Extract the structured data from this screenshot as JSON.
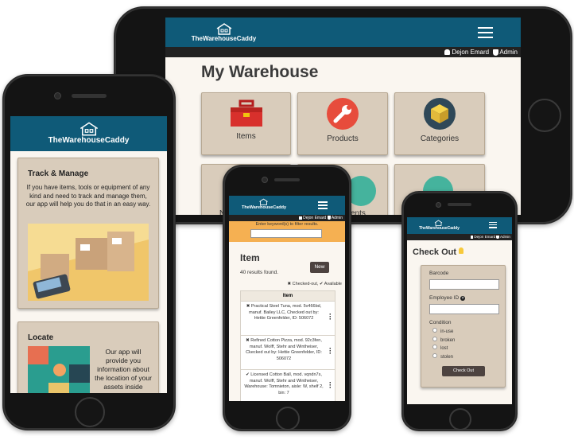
{
  "brand": {
    "name": "TheWarehouseCaddy",
    "color": "#0f5a78"
  },
  "user": {
    "name": "Dejon Emard",
    "role": "Admin"
  },
  "tablet": {
    "page_title": "My Warehouse",
    "tiles": [
      {
        "label": "Items",
        "icon": "toolbox-icon"
      },
      {
        "label": "Products",
        "icon": "wrench-icon"
      },
      {
        "label": "Categories",
        "icon": "box-icon"
      }
    ],
    "row2_partial": [
      "N",
      "ents"
    ]
  },
  "phone_left": {
    "card1": {
      "title": "Track & Manage",
      "body": "If you have items, tools or equipment of any kind and need to track and manage them, our app will help you do that in an easy way."
    },
    "card2": {
      "title": "Locate",
      "body": "Our app will provide you information about the location of your assets inside"
    }
  },
  "phone_mid": {
    "filter_hint": "Enter keyword(s) to filter results.",
    "filter_value": "",
    "title": "Item",
    "results": "40 results found.",
    "new_button": "New",
    "legend_checked_out": "Checked-out,",
    "legend_available": "Available",
    "table_header": "Item",
    "rows": [
      {
        "status": "✖",
        "text": "Practical Steel Tuna, mod. 5v466bd, manuf. Bailey LLC, Checked out by: Hettie Greenfelder, ID: 506072"
      },
      {
        "status": "✖",
        "text": "Refined Cotton Pizza, mod. 92c3fen, manuf. Wolff, Stehr and Wintheiser, Ckecked out by: Hettie Greenfelder, ID: 506072"
      },
      {
        "status": "✔",
        "text": "Licensed Cotton Ball, mod. vqndn7s, manuf. Wolff, Stehr and Wintheiser, Warehouse: Tomnieton, aisle: W, shelf 2, bin: 7"
      }
    ]
  },
  "phone_right": {
    "title": "Check Out",
    "barcode_label": "Barcode",
    "barcode_value": "",
    "employee_label": "Employee ID",
    "employee_value": "",
    "condition_label": "Condition",
    "conditions": [
      "in-use",
      "broken",
      "lost",
      "stolen"
    ],
    "submit": "Check Out"
  }
}
